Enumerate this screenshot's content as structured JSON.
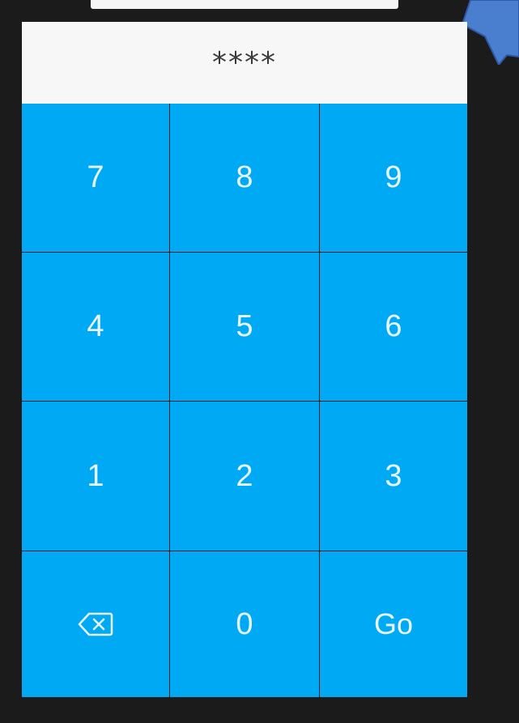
{
  "display": {
    "masked_value": "****"
  },
  "keypad": {
    "keys": [
      "7",
      "8",
      "9",
      "4",
      "5",
      "6",
      "1",
      "2",
      "3",
      "0"
    ],
    "go_label": "Go",
    "backspace_icon": "backspace-icon"
  },
  "colors": {
    "key_background": "#00a9f4",
    "key_text": "#e9f6ff",
    "display_background": "#f7f7f7",
    "screen_background": "#1b1b1c",
    "pointer_arrow": "#4a7fd0"
  }
}
